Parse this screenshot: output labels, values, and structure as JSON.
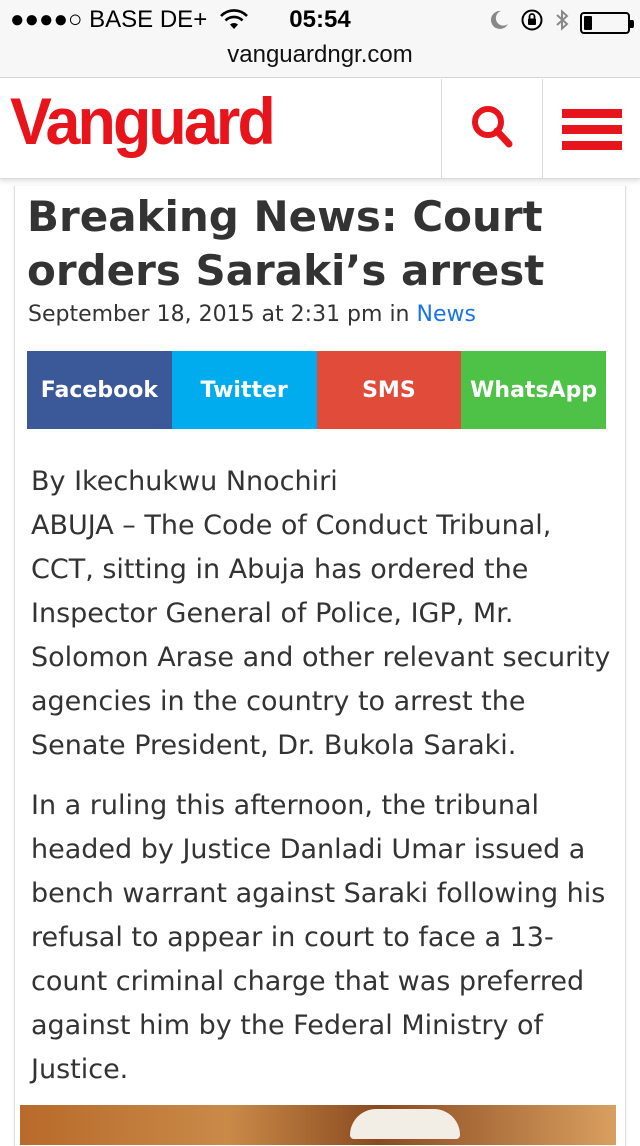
{
  "status_bar": {
    "carrier": "●●●●○ BASE DE+",
    "time": "05:54",
    "battery_level": 0.2
  },
  "browser": {
    "url": "vanguardngr.com"
  },
  "header": {
    "logo_text": "Vanguard",
    "brand_color": "#e8141c",
    "search_icon": "search-icon",
    "menu_icon": "hamburger-menu-icon"
  },
  "article": {
    "title": "Breaking News: Court orders Saraki’s arrest",
    "meta": {
      "date_text": "September 18, 2015 at 2:31 pm in",
      "category": "News"
    },
    "share": {
      "facebook": "Facebook",
      "twitter": "Twitter",
      "sms": "SMS",
      "whatsapp": "WhatsApp"
    },
    "author_line": "By Ikechukwu Nnochiri",
    "paragraph_1": "ABUJA – The Code of Conduct Tribunal, CCT, sitting in Abuja has ordered the Inspector General of Police, IGP, Mr. Solomon Arase and other relevant security agencies in the country to arrest the Senate President, Dr. Bukola Saraki.",
    "paragraph_2": "In a ruling this afternoon, the tribunal headed by Justice Danladi Umar issued a bench warrant against Saraki following his refusal to appear in court to face a 13-count criminal charge that was preferred against him by the Federal Ministry of Justice."
  },
  "colors": {
    "facebook": "#3b5998",
    "twitter": "#00aced",
    "sms": "#e04b3a",
    "whatsapp": "#4dc247",
    "link": "#1a73e8",
    "text": "#333333"
  }
}
